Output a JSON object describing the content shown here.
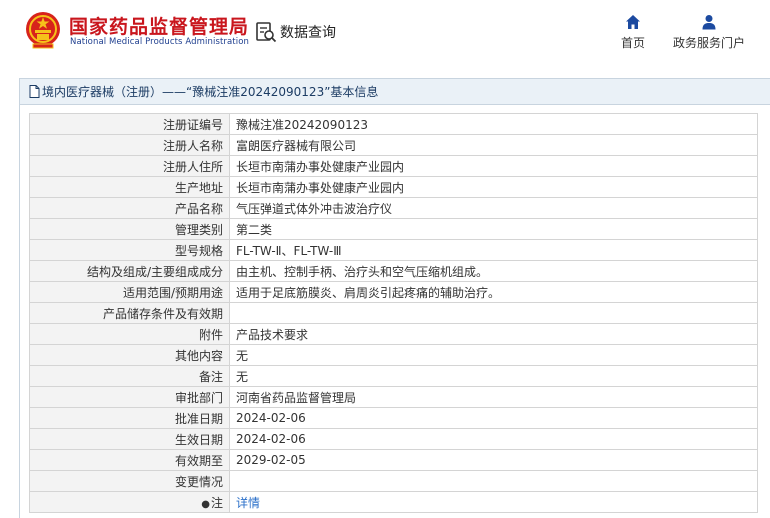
{
  "header": {
    "brand_cn": "国家药品监督管理局",
    "brand_en": "National Medical Products Administration",
    "query_label": "数据查询",
    "nav": [
      {
        "label": "首页",
        "icon": "home-icon"
      },
      {
        "label": "政务服务门户",
        "icon": "person-icon"
      }
    ]
  },
  "panel": {
    "title": "境内医疗器械（注册）——“豫械注准20242090123”基本信息"
  },
  "rows": [
    {
      "key": "注册证编号",
      "value": "豫械注准20242090123"
    },
    {
      "key": "注册人名称",
      "value": "富朗医疗器械有限公司"
    },
    {
      "key": "注册人住所",
      "value": "长垣市南蒲办事处健康产业园内"
    },
    {
      "key": "生产地址",
      "value": "长垣市南蒲办事处健康产业园内"
    },
    {
      "key": "产品名称",
      "value": "气压弹道式体外冲击波治疗仪"
    },
    {
      "key": "管理类别",
      "value": "第二类"
    },
    {
      "key": "型号规格",
      "value": "FL-TW-Ⅱ、FL-TW-Ⅲ"
    },
    {
      "key": "结构及组成/主要组成成分",
      "value": "由主机、控制手柄、治疗头和空气压缩机组成。"
    },
    {
      "key": "适用范围/预期用途",
      "value": "适用于足底筋膜炎、肩周炎引起疼痛的辅助治疗。"
    },
    {
      "key": "产品储存条件及有效期",
      "value": ""
    },
    {
      "key": "附件",
      "value": "产品技术要求"
    },
    {
      "key": "其他内容",
      "value": "无"
    },
    {
      "key": "备注",
      "value": "无"
    },
    {
      "key": "审批部门",
      "value": "河南省药品监督管理局"
    },
    {
      "key": "批准日期",
      "value": "2024-02-06"
    },
    {
      "key": "生效日期",
      "value": "2024-02-06"
    },
    {
      "key": "有效期至",
      "value": "2029-02-05"
    },
    {
      "key": "变更情况",
      "value": ""
    }
  ],
  "note_row": {
    "pin": "●",
    "key": "注",
    "link": "详情"
  },
  "colors": {
    "brand_red": "#c9161d",
    "brand_blue": "#1f3f8f",
    "link": "#2a6fc9",
    "title_bg": "#eaf1f7"
  }
}
